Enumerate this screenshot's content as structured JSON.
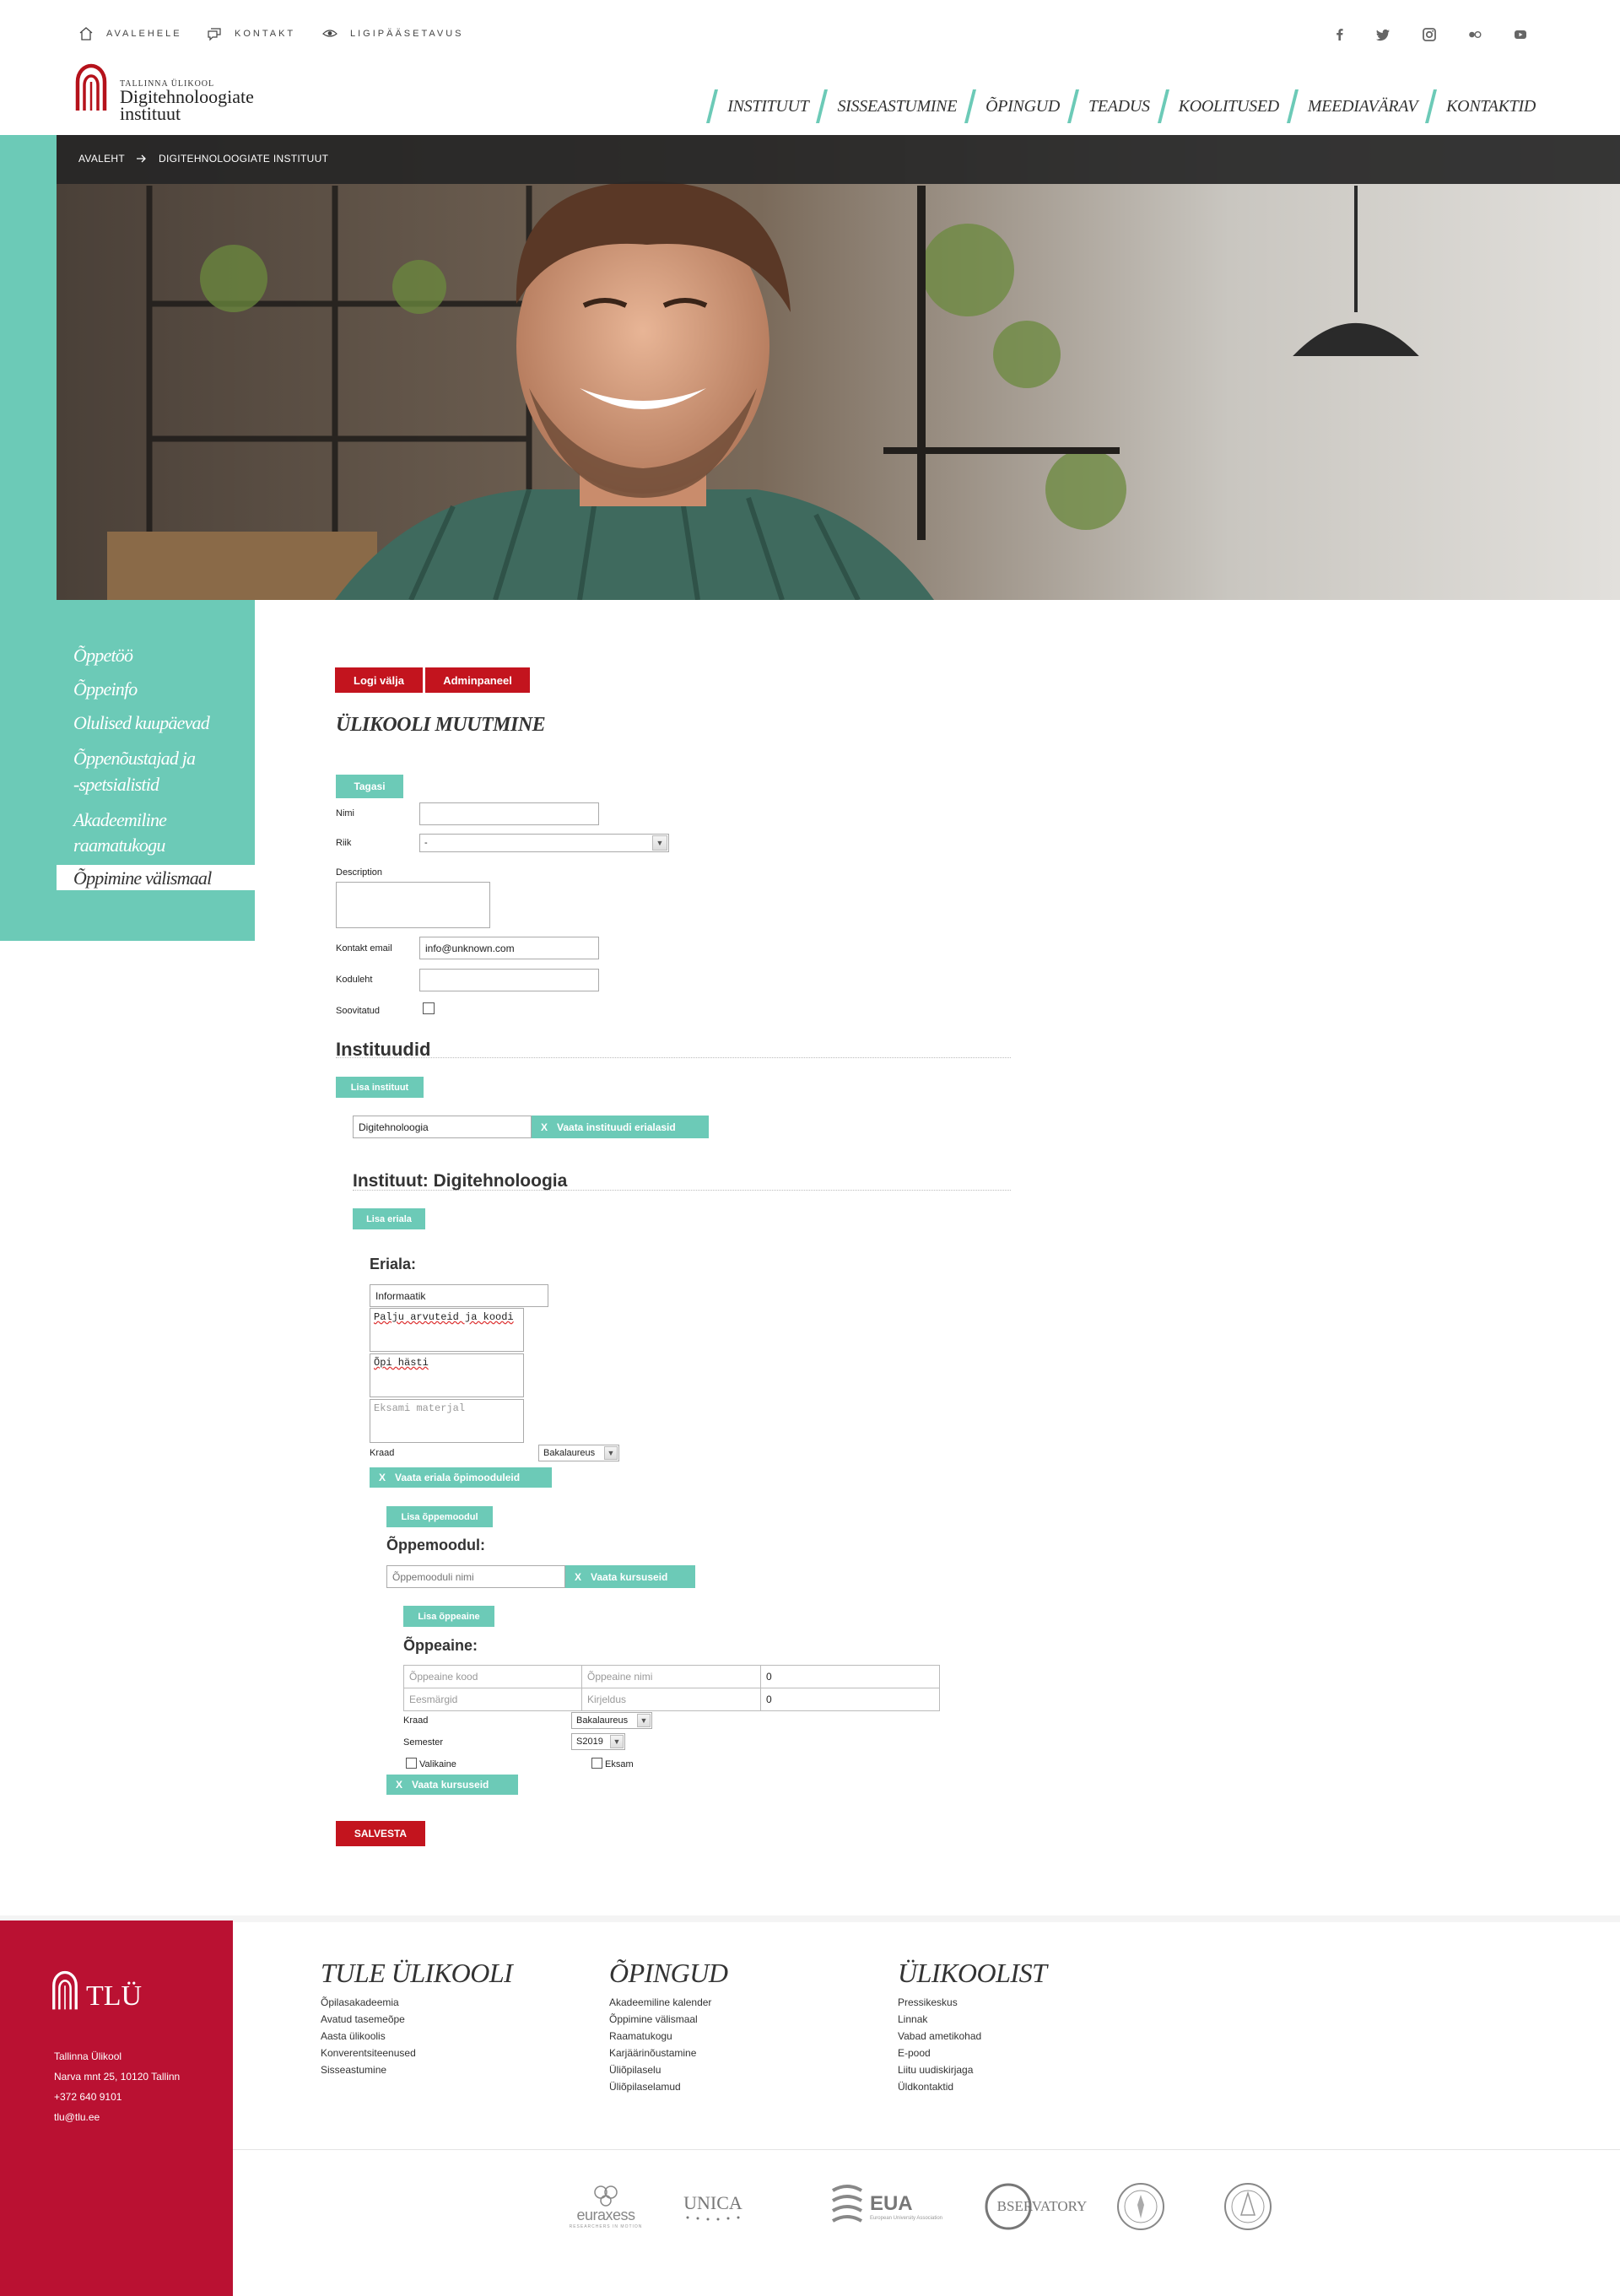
{
  "utility": {
    "home": "AVALEHELE",
    "contact": "KONTAKT",
    "accessibility": "LIGIPÄÄSETAVUS"
  },
  "social": [
    "facebook-icon",
    "twitter-icon",
    "instagram-icon",
    "flickr-icon",
    "youtube-icon"
  ],
  "logo": {
    "small": "TALLINNA ÜLIKOOL",
    "line1": "Digitehnoloogiate",
    "line2": "instituut"
  },
  "nav": [
    "INSTITUUT",
    "SISSEASTUMINE",
    "ÕPINGUD",
    "TEADUS",
    "KOOLITUSED",
    "MEEDIAVÄRAV",
    "KONTAKTID"
  ],
  "breadcrumb": {
    "home": "AVALEHT",
    "current": "DIGITEHNOLOOGIATE INSTITUUT"
  },
  "sidebar": {
    "items": [
      "Õppetöö",
      "Õppeinfo",
      "Olulised kuupäevad",
      "Õppenõustajad ja",
      "-spetsialistid",
      "Akadeemiline",
      "raamatukogu",
      "Õppimine välismaal"
    ]
  },
  "toolbar": {
    "logout": "Logi välja",
    "admin": "Adminpaneel"
  },
  "page_title": "ÜLIKOOLI MUUTMINE",
  "form": {
    "back": "Tagasi",
    "name_label": "Nimi",
    "name_value": "",
    "country_label": "Riik",
    "country_value": "-",
    "description_label": "Description",
    "description_value": "",
    "email_label": "Kontakt email",
    "email_value": "info@unknown.com",
    "homepage_label": "Koduleht",
    "homepage_value": "",
    "recommended_label": "Soovitatud"
  },
  "institutes": {
    "heading": "Instituudid",
    "add": "Lisa instituut",
    "name_value": "Digitehnoloogia",
    "x": "X",
    "view_specialties": "Vaata instituudi erialasid",
    "institute_heading": "Instituut: Digitehnoloogia",
    "add_specialty": "Lisa eriala"
  },
  "specialty": {
    "heading": "Eriala:",
    "name_value": "Informaatik",
    "desc_value": "Palju arvuteid ja koodi",
    "goal_value": "Õpi hästi",
    "exam_placeholder": "Eksami materjal",
    "degree_label": "Kraad",
    "degree_value": "Bakalaureus",
    "x": "X",
    "view_modules": "Vaata eriala õpimooduleid"
  },
  "module": {
    "add": "Lisa õppemoodul",
    "heading": "Õppemoodul:",
    "name_placeholder": "Õppemooduli nimi",
    "x": "X",
    "view_courses": "Vaata kursuseid"
  },
  "subject": {
    "add": "Lisa õppeaine",
    "heading": "Õppeaine:",
    "code_placeholder": "Õppeaine kood",
    "name_placeholder": "Õppeaine nimi",
    "credits_value": "0",
    "goals_placeholder": "Eesmärgid",
    "description_placeholder": "Kirjeldus",
    "credits2_value": "0",
    "degree_label": "Kraad",
    "degree_value": "Bakalaureus",
    "semester_label": "Semester",
    "semester_value": "S2019",
    "elective_label": "Valikaine",
    "exam_label": "Eksam",
    "x": "X",
    "view_courses": "Vaata kursuseid"
  },
  "save": "SALVESTA",
  "footer": {
    "logo_text": "TLÜ",
    "address": [
      "Tallinna Ülikool",
      "Narva mnt 25, 10120 Tallinn",
      "+372 640 9101",
      "tlu@tlu.ee"
    ],
    "columns": [
      {
        "title": "TULE ÜLIKOOLI",
        "links": [
          "Õpilasakadeemia",
          "Avatud tasemeõpe",
          "Aasta ülikoolis",
          "Konverentsiteenused",
          "Sisseastumine"
        ]
      },
      {
        "title": "ÕPINGUD",
        "links": [
          "Akadeemiline kalender",
          "Õppimine välismaal",
          "Raamatukogu",
          "Karjäärinõustamine",
          "Üliõpilaselu",
          "Üliõpilaselamud"
        ]
      },
      {
        "title": "ÜLIKOOLIST",
        "links": [
          "Pressikeskus",
          "Linnak",
          "Vabad ametikohad",
          "E-pood",
          "Liitu uudiskirjaga",
          "Üldkontaktid"
        ]
      }
    ],
    "partners": {
      "euraxess": "euraxess",
      "euraxess_sub": "RESEARCHERS IN MOTION",
      "unica": "UNICA",
      "eua": "EUA",
      "eua_sub": "European University Association",
      "observatory": "BSERVATORY"
    }
  },
  "colors": {
    "teal": "#6ccab7",
    "red": "#c3141e",
    "footer_red": "#ba1132"
  }
}
